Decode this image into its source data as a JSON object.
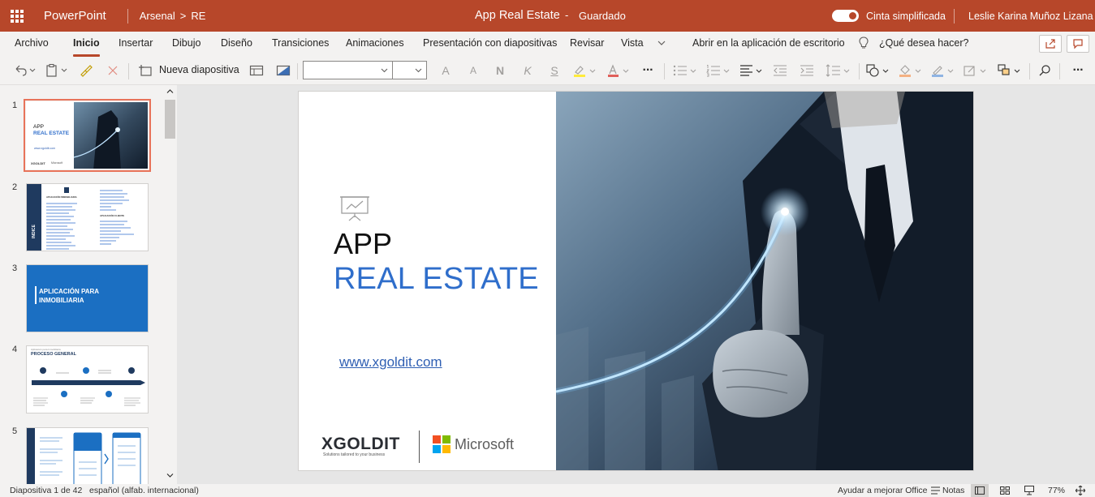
{
  "titlebar": {
    "app_name": "PowerPoint",
    "breadcrumb_folder": "Arsenal",
    "breadcrumb_sep": ">",
    "breadcrumb_file": "RE",
    "doc_title": "App Real Estate",
    "dash": "-",
    "save_status": "Guardado",
    "simplified_ribbon_label": "Cinta simplificada",
    "simplified_ribbon_on": true,
    "user_name": "Leslie Karina Muñoz Lizana",
    "accent_color": "#b7472a"
  },
  "ribbon": {
    "tabs": [
      {
        "label": "Archivo",
        "active": false
      },
      {
        "label": "Inicio",
        "active": true
      },
      {
        "label": "Insertar",
        "active": false
      },
      {
        "label": "Dibujo",
        "active": false
      },
      {
        "label": "Diseño",
        "active": false
      },
      {
        "label": "Transiciones",
        "active": false
      },
      {
        "label": "Animaciones",
        "active": false
      },
      {
        "label": "Presentación con diapositivas",
        "active": false
      },
      {
        "label": "Revisar",
        "active": false
      },
      {
        "label": "Vista",
        "active": false
      }
    ],
    "open_desktop": "Abrir en la aplicación de escritorio",
    "tell_me": "¿Qué desea hacer?"
  },
  "toolbar": {
    "new_slide_label": "Nueva diapositiva",
    "font_name_value": "",
    "font_size_value": "",
    "glyph_increase_font": "A",
    "glyph_decrease_font": "A",
    "glyph_bold": "N",
    "glyph_italic": "K",
    "glyph_underline": "S",
    "glyph_more": "···"
  },
  "thumbnails": [
    {
      "number": "1",
      "selected": true
    },
    {
      "number": "2",
      "selected": false
    },
    {
      "number": "3",
      "selected": false
    },
    {
      "number": "4",
      "selected": false
    },
    {
      "number": "5",
      "selected": false
    }
  ],
  "thumb_text": {
    "t1_app": "APP",
    "t1_re": "REAL ESTATE",
    "t1_url": "www.xgoldit.com",
    "t2_title": "INDICE",
    "t2_h1": "APLICACIÓN INMOBILIARIA",
    "t2_h2": "APLICACIÓN CLIENTE",
    "t3_title": "APLICACIÓN PARA INMOBILIARIA",
    "t4_sub": "Aplicación para Inmobiliaria",
    "t4_title": "PROCESO GENERAL"
  },
  "slide": {
    "title_line1": "APP",
    "title_line2": "REAL ESTATE",
    "url": "www.xgoldit.com",
    "logo1_name": "XGOLDIT",
    "logo1_tagline": "Solutions tailored to your business",
    "logo2_name": "Microsoft",
    "title_color": "#2f6ecb"
  },
  "statusbar": {
    "slide_position": "Diapositiva 1 de 42",
    "language": "español (alfab. internacional)",
    "help_improve": "Ayudar a mejorar Office",
    "notes": "Notas",
    "zoom": "77%"
  }
}
